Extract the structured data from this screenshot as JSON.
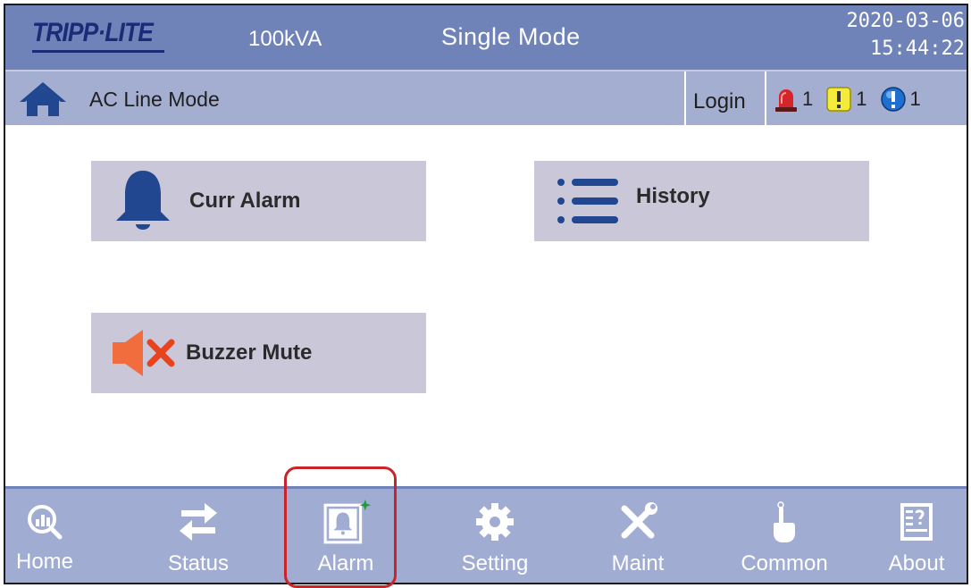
{
  "header": {
    "brand": "TRIPP·LITE",
    "capacity": "100kVA",
    "mode": "Single Mode",
    "date": "2020-03-06",
    "time": "15:44:22"
  },
  "subheader": {
    "line_mode": "AC Line Mode",
    "login_label": "Login",
    "alarm_counts": {
      "critical": "1",
      "warning": "1",
      "info": "1"
    }
  },
  "tiles": {
    "curr_alarm": "Curr Alarm",
    "history": "History",
    "buzzer_mute": "Buzzer Mute"
  },
  "nav": {
    "home": "Home",
    "status": "Status",
    "alarm": "Alarm",
    "setting": "Setting",
    "maint": "Maint",
    "common": "Common",
    "about": "About"
  },
  "colors": {
    "header_blue": "#6f83b9",
    "subheader": "#a3aed1",
    "tile": "#cac7d8",
    "nav": "#a1acd2",
    "icon_navy": "#20478f",
    "mute_orange": "#f26d3d",
    "highlight_red": "#c8252b"
  },
  "icons": {
    "home": "house-icon",
    "critical": "siren-icon",
    "warning": "exclamation-warning-icon",
    "info": "exclamation-info-icon",
    "curr_alarm": "bell-icon",
    "history": "list-icon",
    "buzzer_mute": "speaker-mute-icon"
  }
}
